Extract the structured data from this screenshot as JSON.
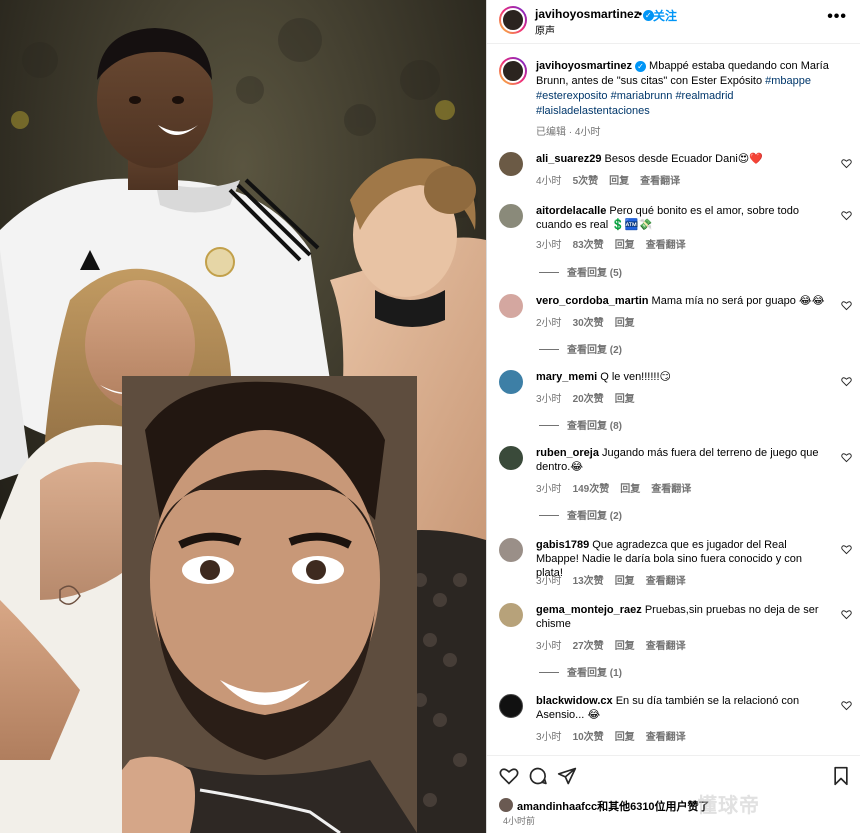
{
  "post": {
    "username": "javihoyosmartinez",
    "follow_sep": "•",
    "follow_label": "关注",
    "audio": "原声",
    "more": "•••",
    "caption_user": "javihoyosmartinez",
    "caption_text": "Mbappé estaba quedando con María Brunn, antes de \"sus citas\" con Ester Expósito",
    "caption_tags": [
      "#mbappe",
      "#esterexposito",
      "#mariabrunn",
      "#realmadrid",
      "#laisladelastentaciones"
    ],
    "caption_meta": "已编辑 · 4小时"
  },
  "comments": [
    {
      "user": "ali_suarez29",
      "text": "Besos desde Ecuador Dani😍❤️",
      "time": "4小时",
      "likes": "5次赞",
      "reply": "回复",
      "translate": "查看翻译",
      "replies": "",
      "avatar_color": "#6b5a45"
    },
    {
      "user": "aitordelacalle",
      "text": "Pero qué bonito es el amor, sobre todo cuando es real 💲🏧💸",
      "time": "3小时",
      "likes": "83次赞",
      "reply": "回复",
      "translate": "查看翻译",
      "replies": "查看回复 (5)",
      "avatar_color": "#8a8a7a"
    },
    {
      "user": "vero_cordoba_martin",
      "text": "Mama mía no será por guapo 😂😂",
      "time": "2小时",
      "likes": "30次赞",
      "reply": "回复",
      "translate": "",
      "replies": "查看回复 (2)",
      "avatar_color": "#d4a7a0"
    },
    {
      "user": "mary_memi",
      "text": "Q le ven!!!!!!😏",
      "time": "3小时",
      "likes": "20次赞",
      "reply": "回复",
      "translate": "",
      "replies": "查看回复 (8)",
      "avatar_color": "#3d7fa6"
    },
    {
      "user": "ruben_oreja",
      "text": "Jugando más fuera del terreno de juego que dentro.😂",
      "time": "3小时",
      "likes": "149次赞",
      "reply": "回复",
      "translate": "查看翻译",
      "replies": "查看回复 (2)",
      "avatar_color": "#3a4a3a"
    },
    {
      "user": "gabis1789",
      "text": "Que agradezca que es jugador del Real Mbappe! Nadie le daría bola sino fuera conocido y con plata!",
      "time": "3小时",
      "likes": "13次赞",
      "reply": "回复",
      "translate": "查看翻译",
      "replies": "",
      "avatar_color": "#9a8f88"
    },
    {
      "user": "gema_montejo_raez",
      "text": "Pruebas,sin pruebas no deja de ser chisme",
      "time": "3小时",
      "likes": "27次赞",
      "reply": "回复",
      "translate": "查看翻译",
      "replies": "查看回复 (1)",
      "avatar_color": "#b7a27a"
    },
    {
      "user": "blackwidow.cx",
      "text": "En su día también se la relacionó con Asensio... 😂",
      "time": "3小时",
      "likes": "10次赞",
      "reply": "回复",
      "translate": "查看翻译",
      "replies": "",
      "avatar_color": "#111111"
    }
  ],
  "footer": {
    "likes_text": "amandinhaafcc和其他6310位用户赞了",
    "time": "4小时前",
    "watermark": "懂球帝"
  },
  "colors": {
    "accent": "#0095f6",
    "tag": "#00376b",
    "muted": "#737373"
  },
  "icons": [
    "verified-icon",
    "more-icon",
    "heart-icon",
    "comment-icon",
    "share-icon",
    "bookmark-icon"
  ]
}
